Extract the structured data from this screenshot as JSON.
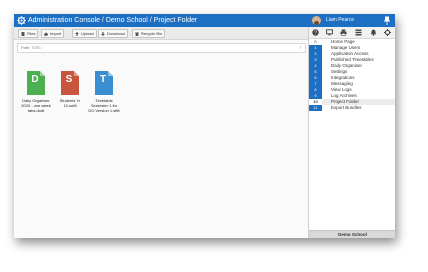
{
  "titlebar": {
    "title": "Administration Console / Demo School / Project Folder",
    "user_name": "Liam Pearce"
  },
  "toolbar": {
    "buttons": [
      {
        "label": "Files",
        "icon": "file-icon"
      },
      {
        "label": "Import",
        "icon": "cloud-icon"
      },
      {
        "label": "Upload",
        "icon": "upload-icon"
      },
      {
        "label": "Download",
        "icon": "download-icon"
      },
      {
        "label": "Recycle Bin",
        "icon": "trash-icon"
      }
    ]
  },
  "pathbar": {
    "path": "Path: TGS /"
  },
  "files": [
    {
      "letter": "D",
      "name": "Daily Organiser 2020 - one week tabs.dodt",
      "color": "#4caf50"
    },
    {
      "letter": "S",
      "name": "Students Yr 10.sutft",
      "color": "#c8553d"
    },
    {
      "letter": "T",
      "name": "Timetable Semester 1 for DO Version 1.sttft",
      "color": "#3b8ed0"
    }
  ],
  "sidebar": {
    "tools": [
      "help-icon",
      "monitor-icon",
      "print-icon",
      "grid-icon",
      "bell-icon",
      "gear-icon"
    ],
    "items": [
      {
        "num": "0",
        "label": "Home Page"
      },
      {
        "num": "1",
        "label": "Manage Users"
      },
      {
        "num": "2",
        "label": "Application Access"
      },
      {
        "num": "3",
        "label": "Published Timetables"
      },
      {
        "num": "4",
        "label": "Daily Organiser"
      },
      {
        "num": "5",
        "label": "Settings"
      },
      {
        "num": "6",
        "label": "Integrations"
      },
      {
        "num": "7",
        "label": "Messaging"
      },
      {
        "num": "8",
        "label": "View Logs"
      },
      {
        "num": "9",
        "label": "Log Archives"
      },
      {
        "num": "10",
        "label": "Project Folder"
      },
      {
        "num": "11",
        "label": "Export Bundles"
      }
    ],
    "footer": "Demo School"
  },
  "colors": {
    "accent": "#1c6fc2"
  }
}
